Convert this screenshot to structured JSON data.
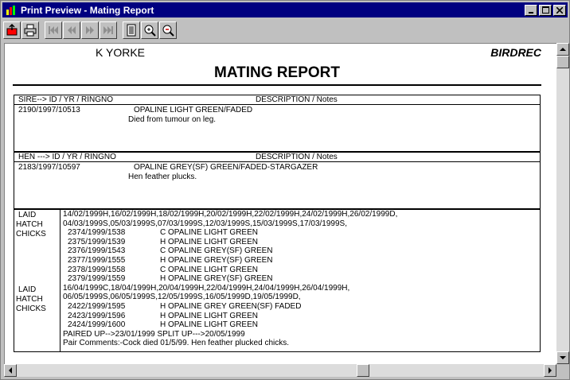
{
  "window": {
    "title": "Print Preview - Mating Report"
  },
  "toolbar": {
    "buttons": [
      "print-setup",
      "print",
      "first-page",
      "previous-page",
      "next-page",
      "last-page",
      "page-view",
      "zoom-in",
      "zoom-out"
    ]
  },
  "report": {
    "owner": "K YORKE",
    "app_name": "BIRDREC",
    "title": "MATING REPORT",
    "sire": {
      "head_left": "SIRE-->  ID / YR / RINGNO",
      "head_right": "DESCRIPTION / Notes",
      "id": "2190/1997/10513",
      "desc": "OPALINE LIGHT GREEN/FADED",
      "note": "Died from tumour on leg."
    },
    "hen": {
      "head_left": "HEN --->  ID / YR / RINGNO",
      "head_right": "DESCRIPTION / Notes",
      "id": "2183/1997/10597",
      "desc": "OPALINE GREY(SF) GREEN/FADED-STARGAZER",
      "note": "Hen feather plucks."
    },
    "labels": {
      "laid1": "LAID",
      "hatch1": "HATCH",
      "chicks1": "CHICKS",
      "laid2": "LAID",
      "hatch2": "HATCH",
      "chicks2": "CHICKS"
    },
    "round1": {
      "laid": "14/02/1999H,16/02/1999H,18/02/1999H,20/02/1999H,22/02/1999H,24/02/1999H,26/02/1999D,",
      "hatch": "04/03/1999S,05/03/1999S,07/03/1999S,12/03/1999S,15/03/1999S,17/03/1999S,",
      "chicks": [
        {
          "id": "2374/1999/1538",
          "desc": "C OPALINE LIGHT GREEN"
        },
        {
          "id": "2375/1999/1539",
          "desc": "H OPALINE LIGHT GREEN"
        },
        {
          "id": "2376/1999/1543",
          "desc": "C OPALINE GREY(SF) GREEN"
        },
        {
          "id": "2377/1999/1555",
          "desc": "H OPALINE GREY(SF) GREEN"
        },
        {
          "id": "2378/1999/1558",
          "desc": "C OPALINE LIGHT GREEN"
        },
        {
          "id": "2379/1999/1559",
          "desc": "H OPALINE GREY(SF) GREEN"
        }
      ]
    },
    "round2": {
      "laid": "16/04/1999C,18/04/1999H,20/04/1999H,22/04/1999H,24/04/1999H,26/04/1999H,",
      "hatch": "06/05/1999S,06/05/1999S,12/05/1999S,16/05/1999D,19/05/1999D,",
      "chicks": [
        {
          "id": "2422/1999/1595",
          "desc": "H OPALINE GREY GREEN(SF) FADED"
        },
        {
          "id": "2423/1999/1596",
          "desc": "H OPALINE LIGHT GREEN"
        },
        {
          "id": "2424/1999/1600",
          "desc": "H OPALINE LIGHT GREEN"
        }
      ]
    },
    "paired": "PAIRED UP-->23/01/1999  SPLIT UP--->20/05/1999",
    "comments": "Pair Comments:-Cock died 01/5/99. Hen feather plucked chicks."
  }
}
